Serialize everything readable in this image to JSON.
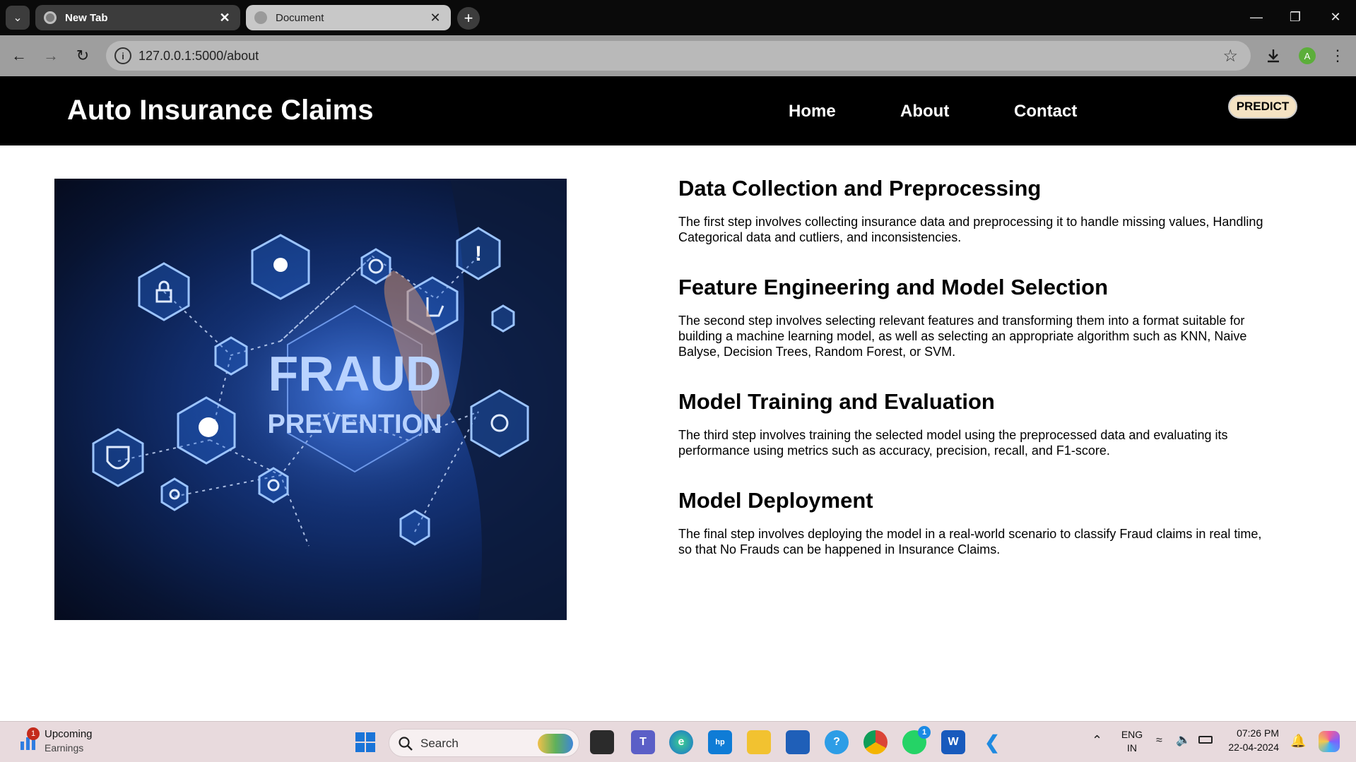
{
  "browser": {
    "tabs": [
      {
        "title": "New Tab",
        "active": false
      },
      {
        "title": "Document",
        "active": true
      }
    ],
    "url": "127.0.0.1:5000/about",
    "profile_initial": "A"
  },
  "site": {
    "brand": "Auto Insurance Claims",
    "nav": [
      "Home",
      "About",
      "Contact"
    ],
    "predict_label": "PREDICT"
  },
  "hero_image": {
    "text_line1": "FRAUD",
    "text_line2": "PREVENTION"
  },
  "sections": [
    {
      "heading": "Data Collection and Preprocessing",
      "body": "The first step involves collecting insurance data and preprocessing it to handle missing values, Handling Categorical data and cutliers, and inconsistencies."
    },
    {
      "heading": "Feature Engineering and Model Selection",
      "body": "The second step involves selecting relevant features and transforming them into a format suitable for building a machine learning model, as well as selecting an appropriate algorithm such as KNN, Naive Balyse, Decision Trees, Random Forest, or SVM."
    },
    {
      "heading": "Model Training and Evaluation",
      "body": "The third step involves training the selected model using the preprocessed data and evaluating its performance using metrics such as accuracy, precision, recall, and F1-score."
    },
    {
      "heading": "Model Deployment",
      "body": "The final step involves deploying the model in a real-world scenario to classify Fraud claims in real time, so that No Frauds can be happened in Insurance Claims."
    }
  ],
  "taskbar": {
    "widget_title": "Upcoming",
    "widget_subtitle": "Earnings",
    "widget_badge": "1",
    "search_placeholder": "Search",
    "whatsapp_badge": "1",
    "lang_line1": "ENG",
    "lang_line2": "IN",
    "time": "07:26 PM",
    "date": "22-04-2024"
  },
  "colors": {
    "site_header_bg": "#000000",
    "predict_bg": "#f5e3c3",
    "browser_tabbar": "#0a0a0a",
    "browser_toolbar": "#9e9e9e"
  }
}
